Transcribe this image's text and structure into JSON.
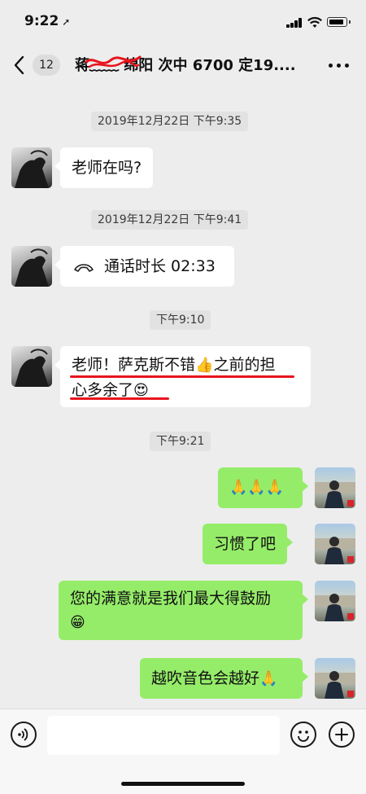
{
  "status_bar": {
    "time": "9:22",
    "location_arrow": "➚"
  },
  "nav": {
    "back_icon": "chevron-left",
    "unread_count": "12",
    "title": "蒋﹏﹏ 绵阳 次中 6700 定19....",
    "more_icon": "ellipsis"
  },
  "messages": [
    {
      "type": "timestamp",
      "text": "2019年12月22日 下午9:35"
    },
    {
      "type": "incoming",
      "text": "老师在吗?"
    },
    {
      "type": "timestamp",
      "text": "2019年12月22日 下午9:41"
    },
    {
      "type": "incoming-call",
      "call_icon": "phone-hangup",
      "text": "通话时长 02:33"
    },
    {
      "type": "timestamp",
      "text": "下午9:10"
    },
    {
      "type": "incoming",
      "line1": "老师！萨克斯不错",
      "emoji1": "👍",
      "line1_tail": "之前的担",
      "line2": "心多余了",
      "emoji2": "😍"
    },
    {
      "type": "timestamp",
      "text": "下午9:21"
    },
    {
      "type": "outgoing",
      "text": "🙏🙏🙏"
    },
    {
      "type": "outgoing",
      "text": "习惯了吧"
    },
    {
      "type": "outgoing",
      "line1": "您的满意就是我们最大得鼓励",
      "emoji": "😁"
    },
    {
      "type": "outgoing",
      "text": "越吹音色会越好",
      "emoji": "🙏"
    }
  ],
  "input_bar": {
    "voice_icon": "voice",
    "emoji_icon": "smiley",
    "plus_icon": "plus",
    "placeholder": ""
  },
  "colors": {
    "background": "#ededed",
    "incoming_bubble": "#ffffff",
    "outgoing_bubble": "#95ec69",
    "annotation_red": "#e8141d"
  }
}
